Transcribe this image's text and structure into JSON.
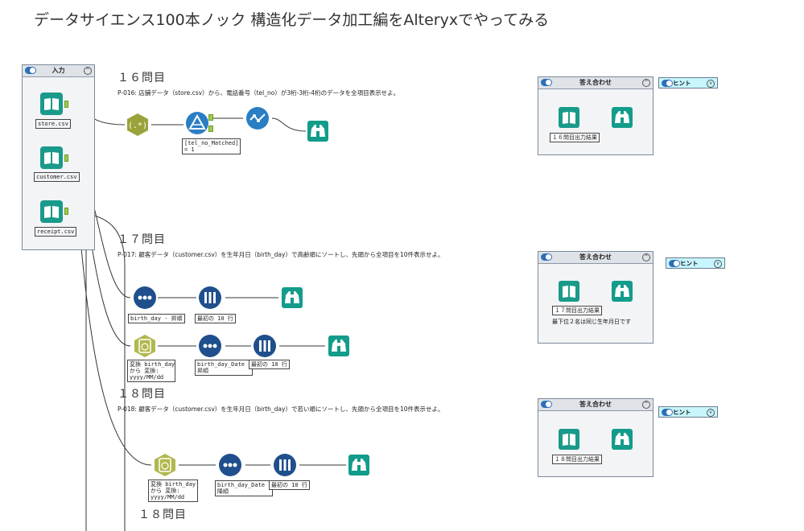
{
  "page_title": "データサイエンス100本ノック 構造化データ加工編をAlteryxでやってみる",
  "input_container": {
    "label": "入力",
    "files": [
      "store.csv",
      "customer.csv",
      "receipt.csv"
    ]
  },
  "q16": {
    "title": "１６問目",
    "description": "P-016: 店舗データ（store.csv）から、電話番号（tel_no）が3桁-3桁-4桁のデータを全項目表示せよ。",
    "filter_annotation_line1": "[tel_no_Matched]",
    "filter_annotation_line2": "= 1",
    "answer_label": "答え合わせ",
    "answer_caption": "１６問目出力結果",
    "hint_label": "ヒント"
  },
  "q17": {
    "title": "１７問目",
    "description": "P-017: 顧客データ（customer.csv）を生年月日（birth_day）で高齢順にソートし、先頭から全項目を10件表示せよ。",
    "row1_sort_annotation": "birth_day - 昇順",
    "row1_sample_annotation": "最初の 10 行",
    "row2_convert_line1": "変換 birth_day",
    "row2_convert_line2": "から 変換:",
    "row2_convert_line3": "yyyy/MM/dd",
    "row2_sort_line1": "birth_day_Date -",
    "row2_sort_line2": "昇順",
    "row2_sample_annotation": "最初の 10 行",
    "answer_label": "答え合わせ",
    "answer_caption": "１７問目出力結果",
    "answer_note": "最下位２名は同じ生年月日です",
    "hint_label": "ヒント"
  },
  "q18": {
    "title": "１８問目",
    "description": "P-018: 顧客データ（customer.csv）を生年月日（birth_day）で若い順にソートし、先頭から全項目を10件表示せよ。",
    "convert_line1": "変換 birth_day",
    "convert_line2": "から 変換:",
    "convert_line3": "yyyy/MM/dd",
    "sort_line1": "birth_day_Date -",
    "sort_line2": "降順",
    "sample_annotation": "最初の 10 行",
    "answer_label": "答え合わせ",
    "answer_caption": "１８問目出力結果",
    "hint_label": "ヒント",
    "footer_title": "１８問目"
  },
  "colors": {
    "input_green": "#1a9a8a",
    "regex_olive": "#9aa33b",
    "filter_blue": "#2a7ec4",
    "select_blue": "#2a7ec4",
    "browse_green": "#139c8a",
    "sort_navy": "#1f4f8c",
    "datetime_olive": "#b1b84e",
    "anchor_green": "#9ccc4a",
    "hint_cyan": "#c7f6ff"
  }
}
